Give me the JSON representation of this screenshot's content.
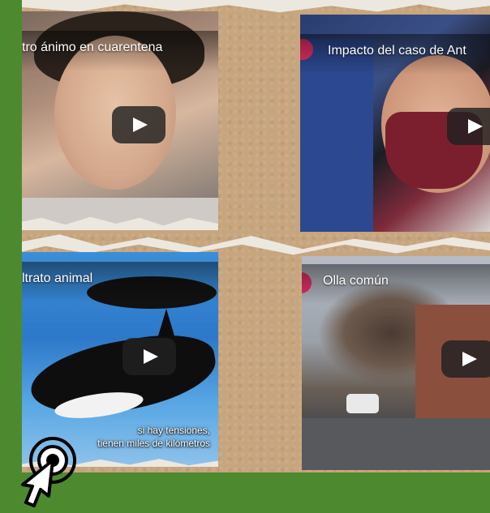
{
  "videos": [
    {
      "title": "tro ánimo en cuarentena"
    },
    {
      "title": "Impacto del caso de Ant"
    },
    {
      "title": "ltrato animal",
      "caption_line1": "si hay tensiones,",
      "caption_line2": "tienen miles de kilómetros"
    },
    {
      "title": "Olla común"
    }
  ],
  "icons": {
    "play": "play-icon",
    "cursor": "click-cursor-icon"
  },
  "colors": {
    "background": "#4d8a2f",
    "board": "#c7a57e",
    "channel_accent": "#e8306a"
  }
}
